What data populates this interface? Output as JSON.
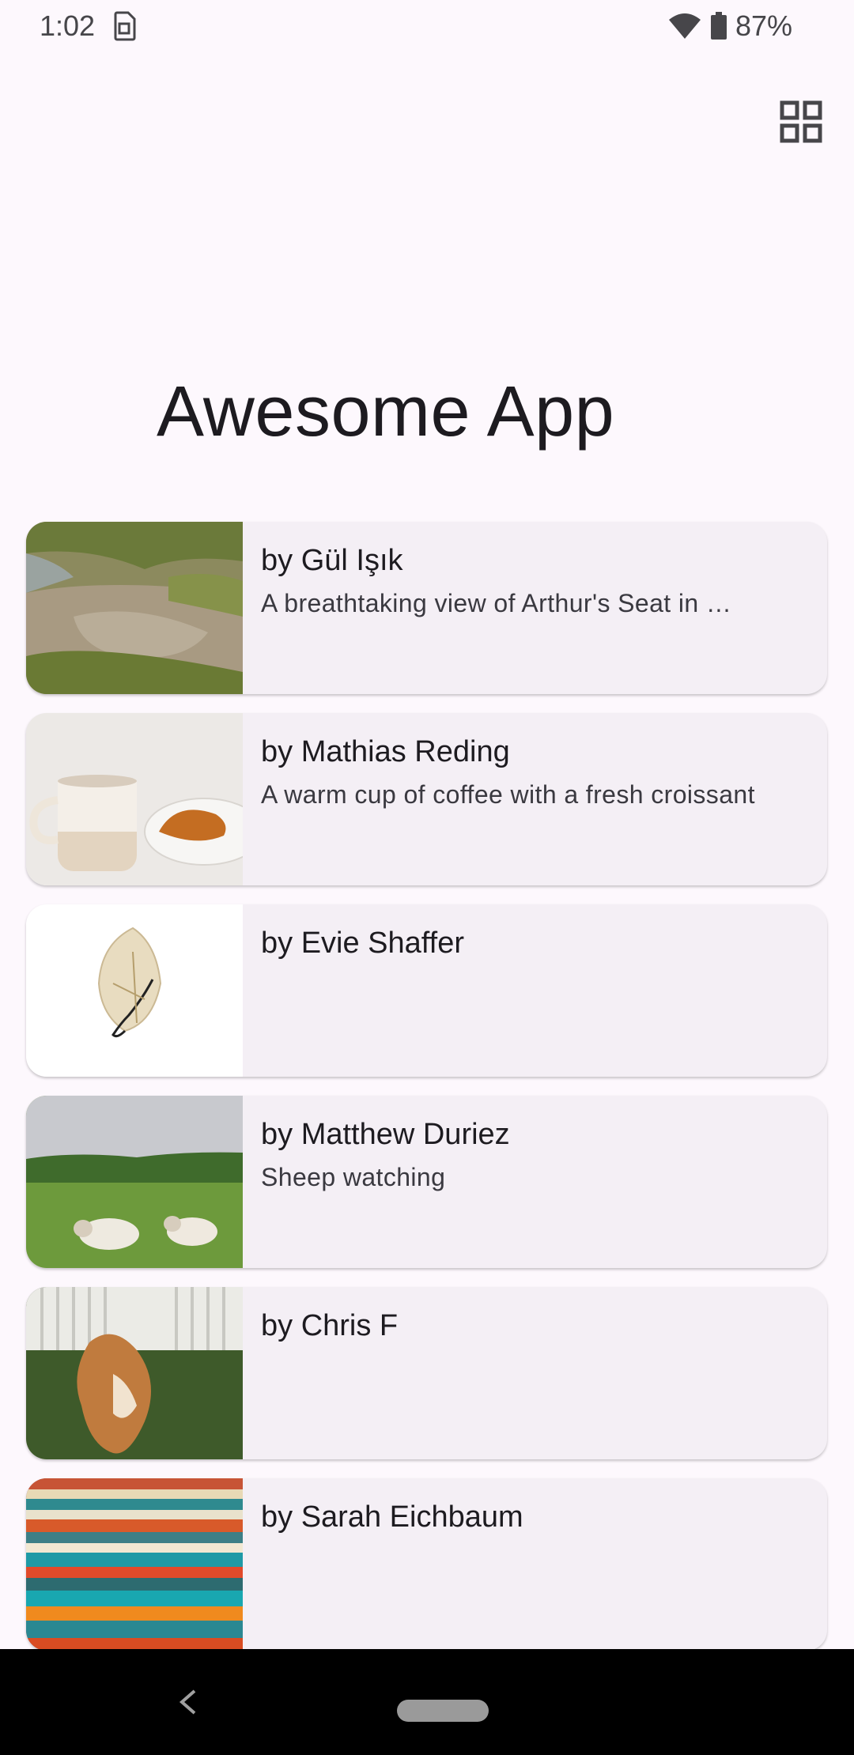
{
  "status_bar": {
    "time": "1:02",
    "battery": "87%",
    "icons": [
      "sim-icon",
      "wifi-icon",
      "battery-icon"
    ]
  },
  "toolbar": {
    "view_toggle_icon": "grid-view-icon"
  },
  "page": {
    "title": "Awesome App"
  },
  "photos": [
    {
      "author": "by Gül Işık",
      "description": "A breathtaking view of Arthur's Seat in …"
    },
    {
      "author": "by Mathias Reding",
      "description": "A warm cup of coffee with a fresh croissant"
    },
    {
      "author": "by Evie Shaffer",
      "description": ""
    },
    {
      "author": "by Matthew Duriez",
      "description": "Sheep watching"
    },
    {
      "author": "by Chris F",
      "description": ""
    },
    {
      "author": "by Sarah Eichbaum",
      "description": ""
    }
  ],
  "colors": {
    "background": "#fdf8fd",
    "card": "#f4eff5",
    "text": "#1d1b20",
    "nav_bar": "#000000"
  }
}
